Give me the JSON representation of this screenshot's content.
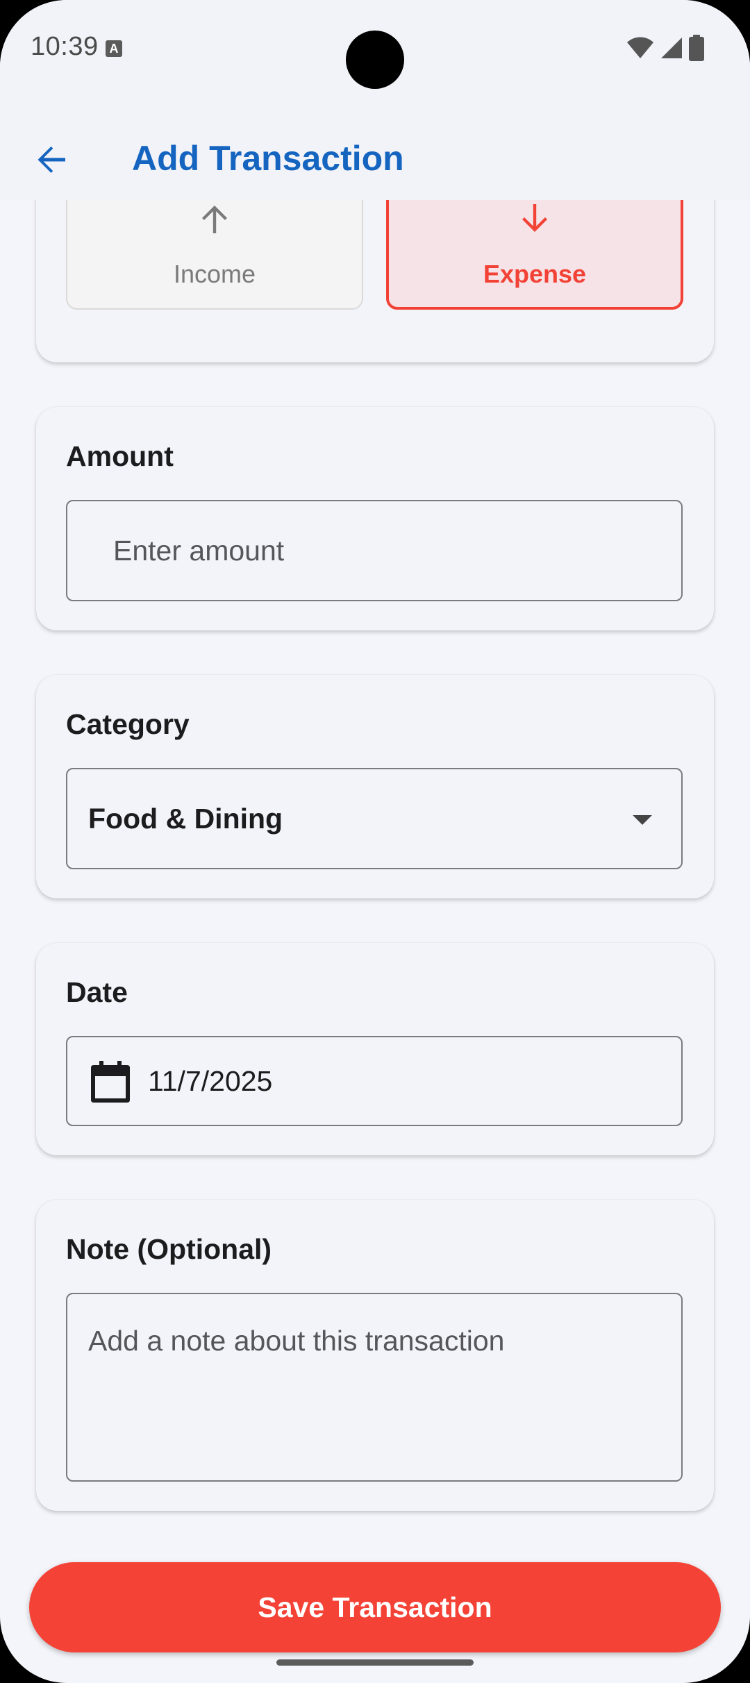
{
  "status_bar": {
    "time": "10:39",
    "notification_icon": "a-icon",
    "icons": [
      "wifi-icon",
      "cellular-signal-icon",
      "battery-icon"
    ]
  },
  "app_bar": {
    "back_icon": "arrow-back-icon",
    "title": "Add Transaction"
  },
  "type_selector": {
    "income": {
      "label": "Income",
      "icon": "arrow-up-icon",
      "selected": false
    },
    "expense": {
      "label": "Expense",
      "icon": "arrow-down-icon",
      "selected": true
    }
  },
  "amount": {
    "label": "Amount",
    "placeholder": "Enter amount",
    "value": ""
  },
  "category": {
    "label": "Category",
    "selected": "Food & Dining",
    "dropdown_icon": "caret-down-icon"
  },
  "date": {
    "label": "Date",
    "icon": "calendar-icon",
    "value": "11/7/2025"
  },
  "note": {
    "label": "Note (Optional)",
    "placeholder": "Add a note about this transaction",
    "value": ""
  },
  "save_button": {
    "label": "Save Transaction"
  },
  "colors": {
    "primary": "#1565c0",
    "expense": "#f44336",
    "expense_selected_bg": "#f6e3e7",
    "background": "#f4f5fa"
  }
}
